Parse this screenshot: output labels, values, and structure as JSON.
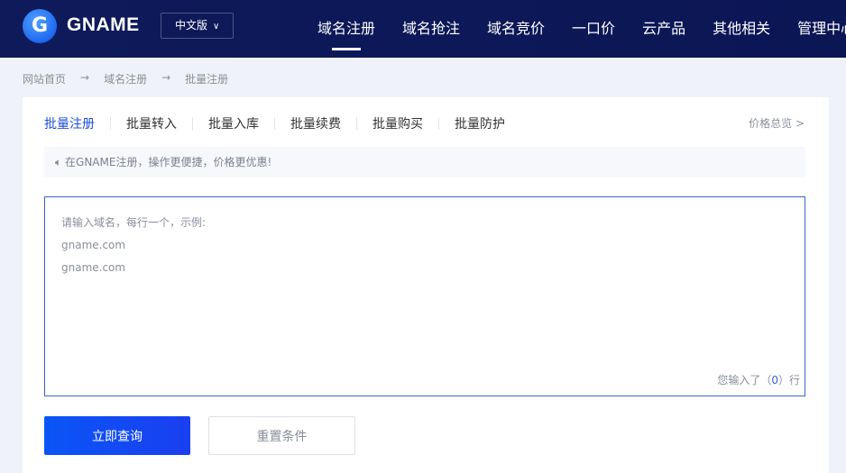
{
  "header": {
    "logo_letter": "G",
    "brand": "GNAME",
    "lang": "中文版",
    "nav": [
      "域名注册",
      "域名抢注",
      "域名竞价",
      "一口价",
      "云产品",
      "其他相关",
      "管理中心"
    ]
  },
  "breadcrumb": [
    "网站首页",
    "域名注册",
    "批量注册"
  ],
  "breadcrumb_sep": "→",
  "tabs": [
    "批量注册",
    "批量转入",
    "批量入库",
    "批量续费",
    "批量购买",
    "批量防护"
  ],
  "price_link": "价格总览",
  "notice": "在GNAME注册，操作更便捷，价格更优惠!",
  "textarea": {
    "placeholder": "请输入域名，每行一个，示例:\ngname.com\ngname.com",
    "count_prefix": "您输入了（",
    "count": "0",
    "count_suffix": "）行"
  },
  "buttons": {
    "query": "立即查询",
    "reset": "重置条件"
  }
}
